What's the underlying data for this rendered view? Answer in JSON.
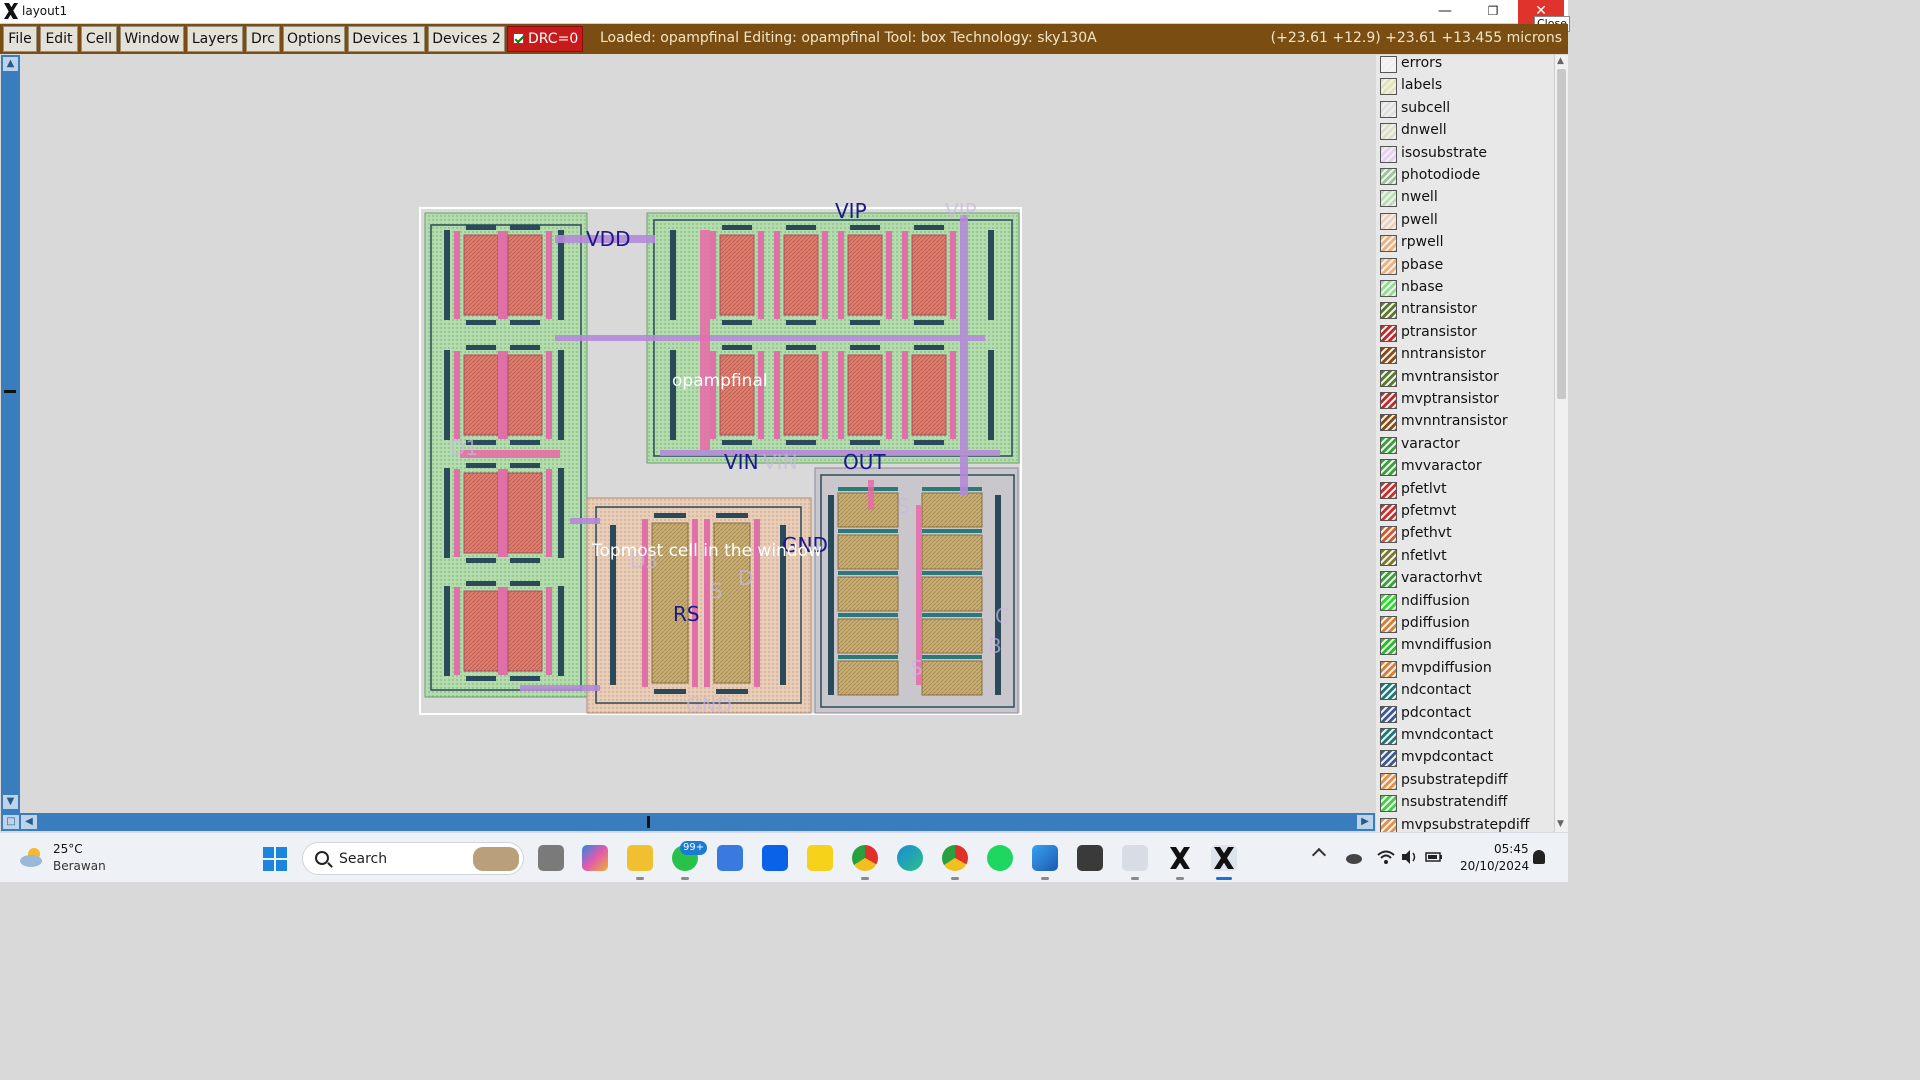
{
  "window": {
    "title": "layout1",
    "minimize_glyph": "—",
    "maximize_glyph": "❐",
    "close_glyph": "✕",
    "close_tooltip": "Close"
  },
  "menubar": {
    "items": [
      "File",
      "Edit",
      "Cell",
      "Window",
      "Layers",
      "Drc",
      "Options",
      "Devices 1",
      "Devices 2"
    ],
    "drc_label": "DRC=0",
    "drc_checked": true,
    "status": "Loaded: opampfinal Editing: opampfinal Tool: box  Technology: sky130A",
    "coordinates": "(+23.61 +12.9) +23.61 +13.455 microns"
  },
  "canvas": {
    "cell_name": "opampfinal",
    "topmost_label": "Topmost cell in the window",
    "net_labels": {
      "vdd": "VDD",
      "vip": "VIP",
      "vin": "VIN",
      "out": "OUT",
      "gnd": "GND",
      "rs": "RS"
    },
    "faint_labels": [
      "VIP",
      "VIN",
      "D1",
      "D3",
      "D",
      "S",
      "GND",
      "S",
      "C",
      "B",
      "S"
    ],
    "colors": {
      "background": "#d9d9d9",
      "nwell": "#a7d8a0",
      "pwell": "#e8c8b0",
      "poly": "#e86a9a",
      "diff": "#d07a70",
      "metal1": "#b98ad8",
      "contact": "#2a4a5a",
      "label": "#1a1a8a"
    }
  },
  "layers": [
    {
      "name": "errors",
      "color": "#f4f4f4"
    },
    {
      "name": "labels",
      "color": "#e4e4b0"
    },
    {
      "name": "subcell",
      "color": "#e0e0e0"
    },
    {
      "name": "dnwell",
      "color": "#e0e0c8"
    },
    {
      "name": "isosubstrate",
      "color": "#e8d0f0"
    },
    {
      "name": "photodiode",
      "color": "#98c898"
    },
    {
      "name": "nwell",
      "color": "#b8e0b0"
    },
    {
      "name": "pwell",
      "color": "#f0d0b8"
    },
    {
      "name": "rpwell",
      "color": "#f0b078"
    },
    {
      "name": "pbase",
      "color": "#f0b078"
    },
    {
      "name": "nbase",
      "color": "#90e090"
    },
    {
      "name": "ntransistor",
      "color": "#5a7a2a"
    },
    {
      "name": "ptransistor",
      "color": "#c02a2a"
    },
    {
      "name": "nntransistor",
      "color": "#8a4a10"
    },
    {
      "name": "mvntransistor",
      "color": "#5a7a2a"
    },
    {
      "name": "mvptransistor",
      "color": "#c02a2a"
    },
    {
      "name": "mvnntransistor",
      "color": "#8a4a10"
    },
    {
      "name": "varactor",
      "color": "#3aa03a"
    },
    {
      "name": "mvvaractor",
      "color": "#3aa03a"
    },
    {
      "name": "pfetlvt",
      "color": "#d02a2a"
    },
    {
      "name": "pfetmvt",
      "color": "#d02a2a"
    },
    {
      "name": "pfethvt",
      "color": "#d05a2a"
    },
    {
      "name": "nfetlvt",
      "color": "#7a7a2a"
    },
    {
      "name": "varactorhvt",
      "color": "#3aa03a"
    },
    {
      "name": "ndiffusion",
      "color": "#22e022"
    },
    {
      "name": "pdiffusion",
      "color": "#d88030"
    },
    {
      "name": "mvndiffusion",
      "color": "#22c022"
    },
    {
      "name": "mvpdiffusion",
      "color": "#d88030"
    },
    {
      "name": "ndcontact",
      "color": "#1a7a7a"
    },
    {
      "name": "pdcontact",
      "color": "#3a5a9a"
    },
    {
      "name": "mvndcontact",
      "color": "#1a7a7a"
    },
    {
      "name": "mvpdcontact",
      "color": "#3a5a9a"
    },
    {
      "name": "psubstratepdiff",
      "color": "#e89040"
    },
    {
      "name": "nsubstratendiff",
      "color": "#40d040"
    },
    {
      "name": "mvpsubstratepdiff",
      "color": "#e89040"
    }
  ],
  "taskbar": {
    "weather_temp": "25°C",
    "weather_desc": "Berawan",
    "search_label": "Search",
    "whatsapp_badge": "99+",
    "time": "05:45",
    "date": "20/10/2024",
    "icons": [
      "start-icon",
      "task-view-icon",
      "copilot-icon",
      "file-explorer-icon",
      "whatsapp-icon",
      "microsoft-store-icon",
      "dropbox-icon",
      "sticky-notes-icon",
      "chrome-icon",
      "edge-icon",
      "chrome-profile-icon",
      "spotify-icon",
      "photos-icon",
      "snipping-tool-icon",
      "generic-app-icon",
      "xming-icon",
      "magic-layout-icon"
    ]
  }
}
